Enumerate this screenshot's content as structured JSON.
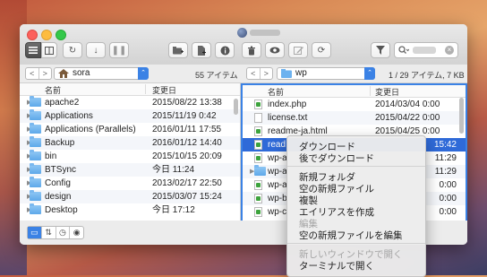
{
  "toolbar": {
    "buttons": [
      "list-view",
      "column-view",
      "refresh",
      "download",
      "pause",
      "new-folder",
      "new-file",
      "info",
      "delete",
      "preview",
      "edit",
      "sync"
    ],
    "filter_icon": "filter-icon",
    "search_placeholder": ""
  },
  "left_pane": {
    "path": "sora",
    "count": "55 アイテム",
    "columns": {
      "name": "名前",
      "modified": "変更日"
    },
    "rows": [
      {
        "name": "apache2",
        "date": "2015/08/22 13:38",
        "type": "folder"
      },
      {
        "name": "Applications",
        "date": "2015/11/19 0:42",
        "type": "folder"
      },
      {
        "name": "Applications (Parallels)",
        "date": "2016/01/11 17:55",
        "type": "folder"
      },
      {
        "name": "Backup",
        "date": "2016/01/12 14:40",
        "type": "folder"
      },
      {
        "name": "bin",
        "date": "2015/10/15 20:09",
        "type": "folder"
      },
      {
        "name": "BTSync",
        "date": "今日 11:24",
        "type": "folder"
      },
      {
        "name": "Config",
        "date": "2013/02/17 22:50",
        "type": "folder"
      },
      {
        "name": "design",
        "date": "2015/03/07 15:24",
        "type": "folder"
      },
      {
        "name": "Desktop",
        "date": "今日 17:12",
        "type": "folder"
      }
    ]
  },
  "right_pane": {
    "path": "wp",
    "count": "1 / 29 アイテム, 7 KB",
    "columns": {
      "name": "名前",
      "modified": "変更日"
    },
    "rows": [
      {
        "name": "index.php",
        "date": "2014/03/04 0:00",
        "type": "php"
      },
      {
        "name": "license.txt",
        "date": "2015/04/22 0:00",
        "type": "txt"
      },
      {
        "name": "readme-ja.html",
        "date": "2015/04/25 0:00",
        "type": "html"
      },
      {
        "name": "read",
        "date": "15:42",
        "type": "html",
        "selected": true
      },
      {
        "name": "wp-a",
        "date": "11:29",
        "type": "php"
      },
      {
        "name": "wp-a",
        "date": "11:29",
        "type": "folder"
      },
      {
        "name": "wp-a",
        "date": "0:00",
        "type": "php"
      },
      {
        "name": "wp-b",
        "date": "0:00",
        "type": "php"
      },
      {
        "name": "wp-c",
        "date": "0:00",
        "type": "php"
      }
    ]
  },
  "context_menu": {
    "groups": [
      [
        {
          "label": "ダウンロード",
          "disabled": false
        },
        {
          "label": "後でダウンロード",
          "disabled": false
        }
      ],
      [
        {
          "label": "新規フォルダ",
          "disabled": false
        },
        {
          "label": "空の新規ファイル",
          "disabled": false
        },
        {
          "label": "複製",
          "disabled": false
        },
        {
          "label": "エイリアスを作成",
          "disabled": false
        },
        {
          "label": "編集",
          "disabled": true
        },
        {
          "label": "空の新規ファイルを編集",
          "disabled": false
        }
      ],
      [
        {
          "label": "新しいウィンドウで開く",
          "disabled": true
        },
        {
          "label": "ターミナルで開く",
          "disabled": false
        }
      ]
    ]
  },
  "colors": {
    "accent": "#3b82e5",
    "selection": "#2f6ad8"
  }
}
